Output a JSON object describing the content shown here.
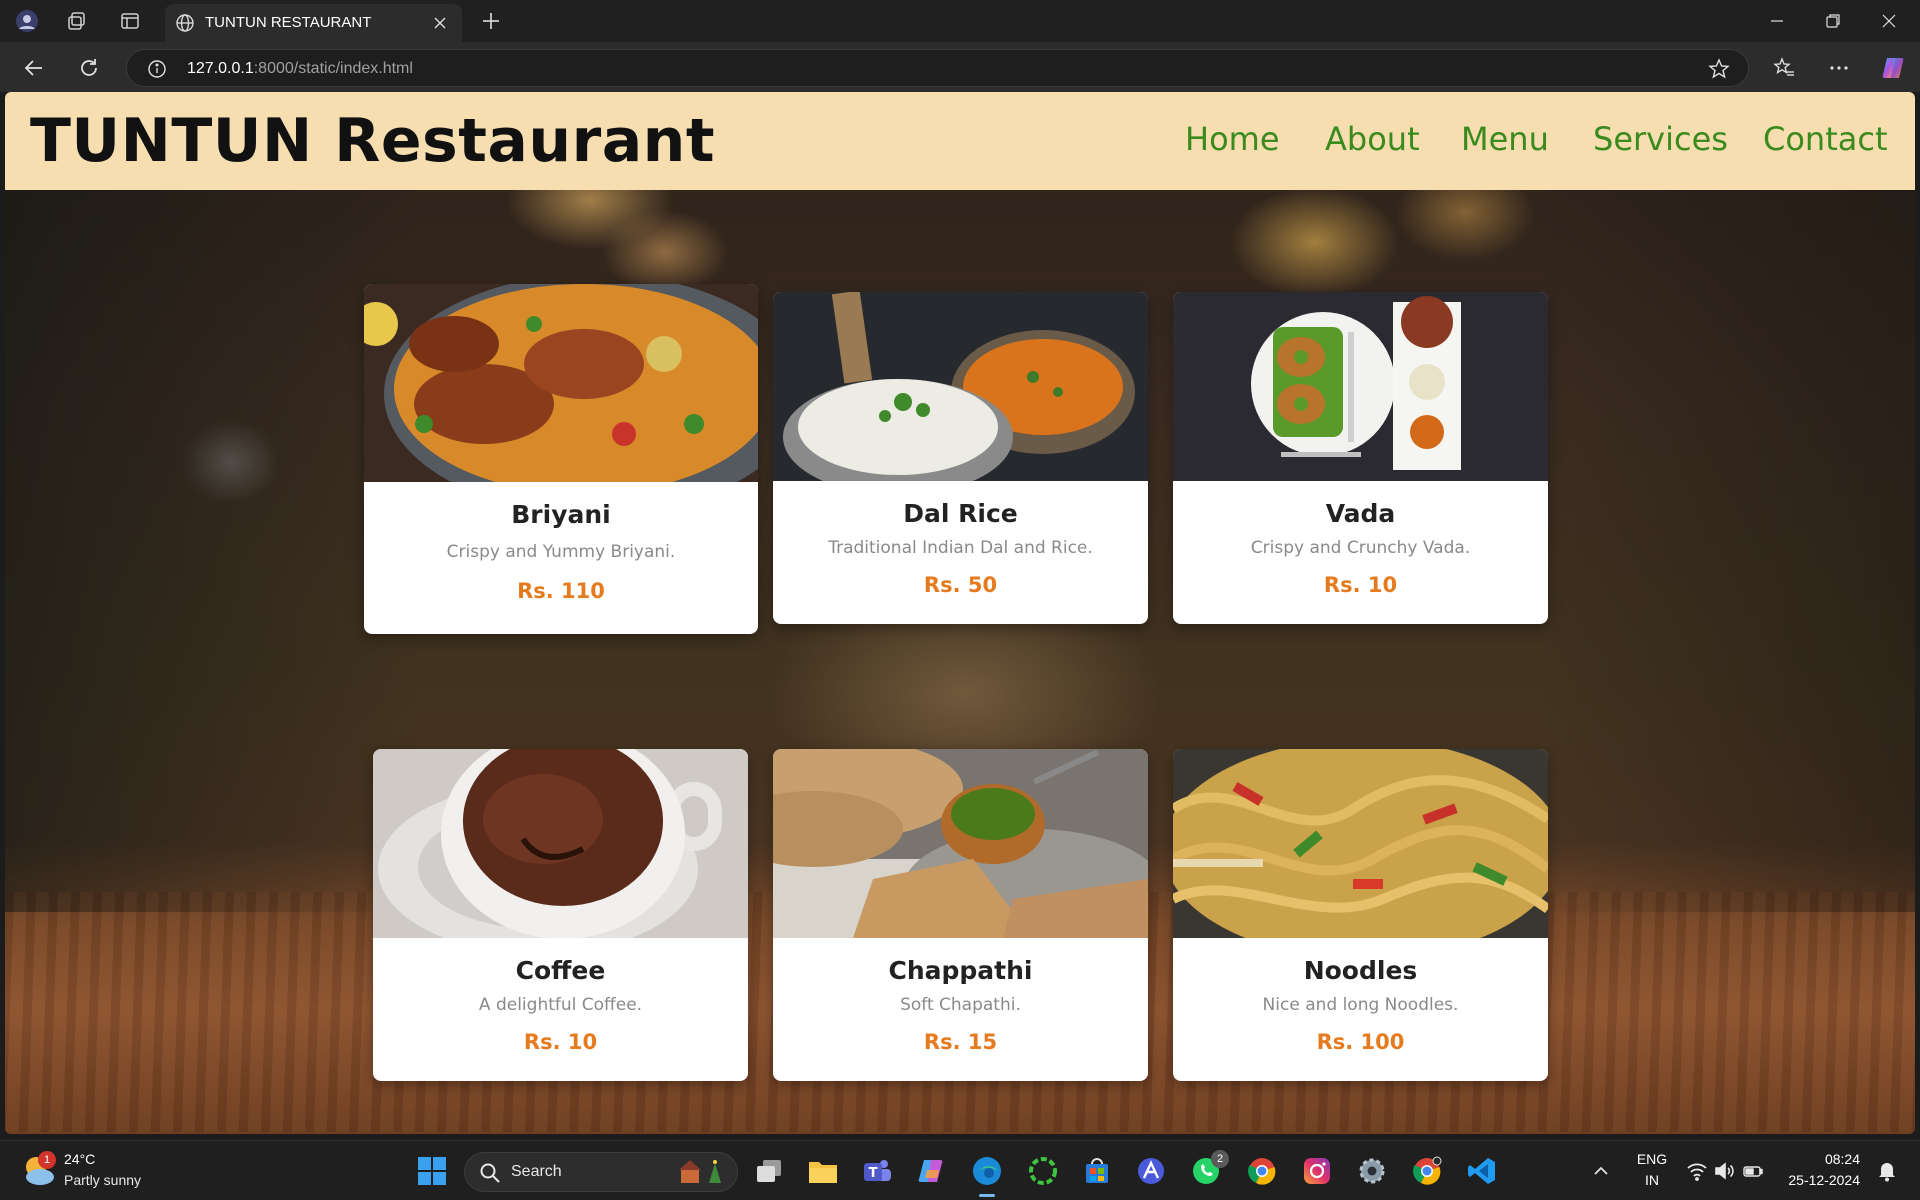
{
  "browser": {
    "tab_title": "TUNTUN RESTAURANT",
    "url_host": "127.0.0.1",
    "url_path": ":8000/static/index.html"
  },
  "site": {
    "title": "TUNTUN Restaurant",
    "nav": [
      "Home",
      "About",
      "Menu",
      "Services",
      "Contact"
    ]
  },
  "menu": [
    {
      "name": "Briyani",
      "desc": "Crispy and Yummy Briyani.",
      "price": "Rs. 110"
    },
    {
      "name": "Dal Rice",
      "desc": "Traditional Indian Dal and Rice.",
      "price": "Rs. 50"
    },
    {
      "name": "Vada",
      "desc": "Crispy and Crunchy Vada.",
      "price": "Rs. 10"
    },
    {
      "name": "Coffee",
      "desc": "A delightful Coffee.",
      "price": "Rs. 10"
    },
    {
      "name": "Chappathi",
      "desc": "Soft Chapathi.",
      "price": "Rs. 15"
    },
    {
      "name": "Noodles",
      "desc": "Nice and long Noodles.",
      "price": "Rs. 100"
    }
  ],
  "taskbar": {
    "weather_temp": "24°C",
    "weather_desc": "Partly sunny",
    "weather_badge": "1",
    "search_placeholder": "Search",
    "whatsapp_badge": "2",
    "lang_top": "ENG",
    "lang_bottom": "IN",
    "time": "08:24",
    "date": "25-12-2024"
  },
  "colors": {
    "header_bg": "#f6deb0",
    "nav_link": "#3a8a1e",
    "price": "#e57b1e"
  }
}
